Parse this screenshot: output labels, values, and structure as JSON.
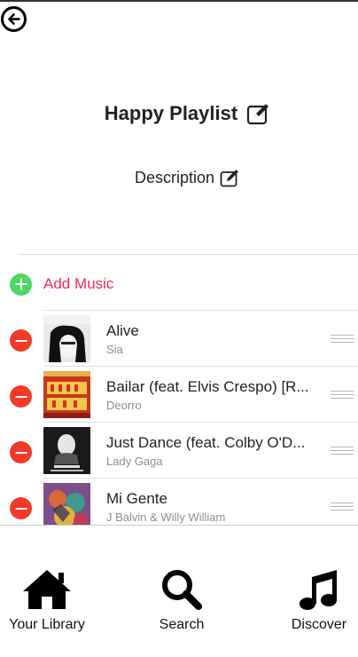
{
  "header": {
    "back_icon": "arrow-left-circle-icon"
  },
  "playlist": {
    "title": "Happy Playlist",
    "description": "Description",
    "edit_icon": "edit-icon"
  },
  "add_music": {
    "label": "Add Music",
    "icon": "plus-circle-icon"
  },
  "tracks": [
    {
      "title": "Alive",
      "artist": "Sia"
    },
    {
      "title": "Bailar (feat. Elvis Crespo) [R...",
      "artist": "Deorro"
    },
    {
      "title": "Just Dance (feat. Colby O'D...",
      "artist": "Lady Gaga"
    },
    {
      "title": "Mi Gente",
      "artist": "J Balvin & Willy William"
    }
  ],
  "tabbar": {
    "library": {
      "label": "Your Library",
      "icon": "home-icon"
    },
    "search": {
      "label": "Search",
      "icon": "search-icon"
    },
    "discover": {
      "label": "Discover",
      "icon": "music-note-icon"
    }
  },
  "colors": {
    "accent": "#f7265c",
    "add": "#4cd964",
    "remove": "#f23a2a"
  }
}
